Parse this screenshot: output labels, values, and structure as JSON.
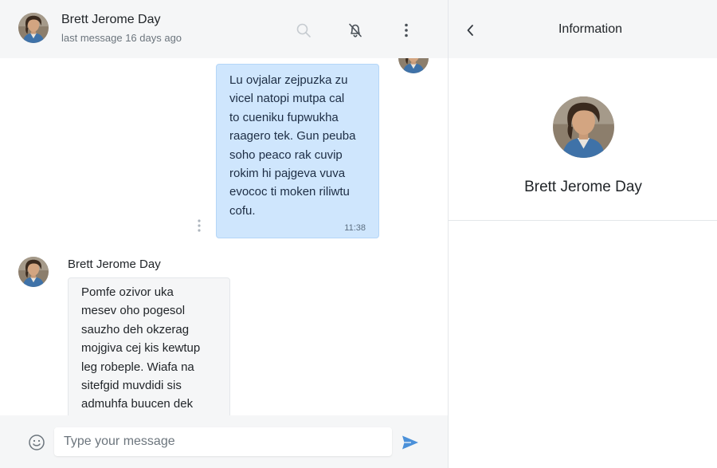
{
  "contact": {
    "name": "Brett Jerome Day",
    "last_seen": "last message 16 days ago"
  },
  "header_icons": [
    "search-icon",
    "bell-off-icon",
    "more-vertical-icon"
  ],
  "messages": [
    {
      "direction": "outgoing",
      "text": "Lu ovjalar zejpuzka zu\nvicel natopi mutpa cal\nto cueniku fupwukha\nraagero tek. Gun peuba\nsoho peaco rak cuvip\nrokim hi pajgeva vuva\nevococ ti moken riliwtu\ncofu.",
      "time": "11:38"
    },
    {
      "direction": "incoming",
      "sender": "Brett Jerome Day",
      "text": "Pomfe ozivor uka\nmesev oho pogesol\nsauzho deh okzerag\nmojgiva cej kis kewtup\nleg robeple. Wiafa na\nsitefgid muvdidi sis\nadmuhfa buucen dek"
    }
  ],
  "composer": {
    "placeholder": "Type your message"
  },
  "info_panel": {
    "title": "Information",
    "name": "Brett Jerome Day"
  },
  "colors": {
    "outgoing_bubble": "#cfe6fd",
    "incoming_bubble": "#f5f6f7",
    "header_bg": "#f5f6f7",
    "send_accent": "#4a90d9"
  }
}
